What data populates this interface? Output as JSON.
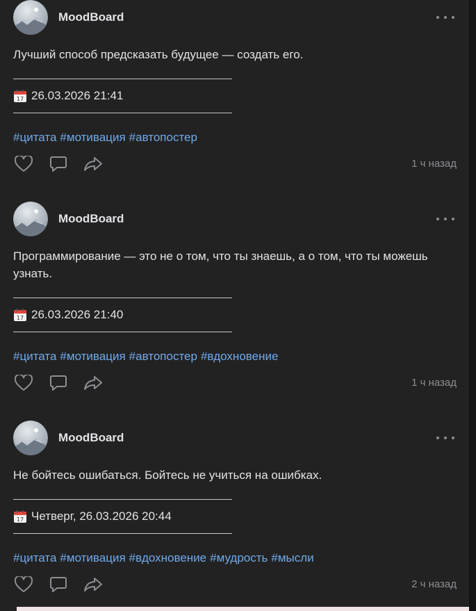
{
  "posts": [
    {
      "author": "MoodBoard",
      "text": "Лучший способ предсказать будущее — создать его.",
      "date": "26.03.2026 21:41",
      "tags": [
        "#цитата",
        "#мотивация",
        "#автопостер"
      ],
      "time_ago": "1 ч назад"
    },
    {
      "author": "MoodBoard",
      "text": "Программирование — это не о том, что ты знаешь, а о том, что ты можешь узнать.",
      "date": "26.03.2026 21:40",
      "tags": [
        "#цитата",
        "#мотивация",
        "#автопостер",
        "#вдохновение"
      ],
      "time_ago": "1 ч назад"
    },
    {
      "author": "MoodBoard",
      "text": "Не бойтесь ошибаться. Бойтесь не учиться на ошибках.",
      "date": "Четверг, 26.03.2026 20:44",
      "tags": [
        "#цитата",
        "#мотивация",
        "#вдохновение",
        "#мудрость",
        "#мысли"
      ],
      "time_ago": "2 ч назад"
    }
  ],
  "icons": {
    "like": "heart-icon",
    "comment": "comment-icon",
    "share": "share-icon",
    "more": "more-horizontal-icon",
    "calendar": "calendar-icon"
  },
  "colors": {
    "background": "#222222",
    "text": "#e1e3e6",
    "link": "#71aaeb",
    "muted": "#8c8f94"
  }
}
